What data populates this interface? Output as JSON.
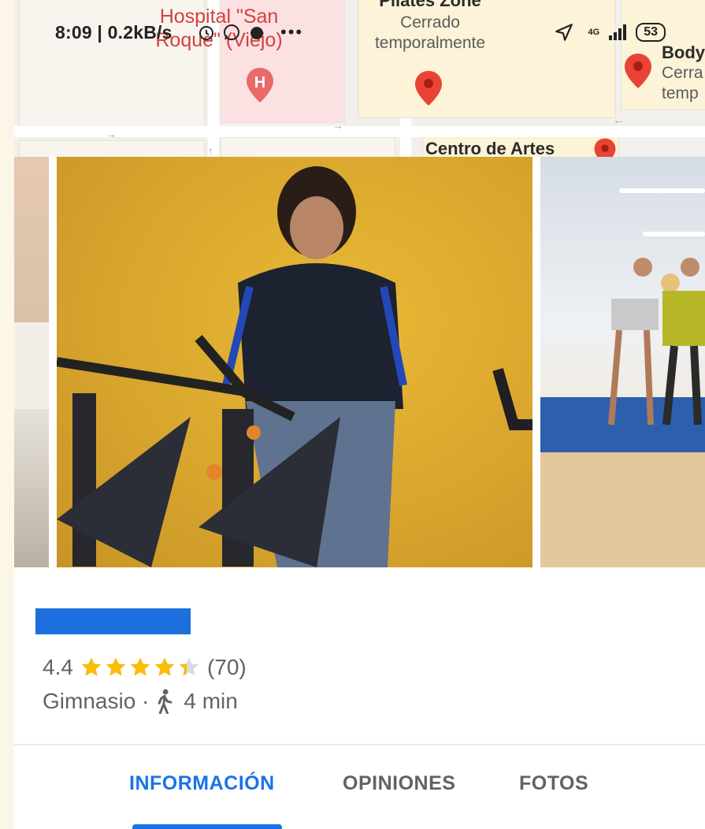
{
  "status_bar": {
    "time": "8:09 | 0.2kB/s",
    "network": "4G",
    "battery": "53"
  },
  "map": {
    "poi_hospital": "Hospital \"San Roque\" (Viejo)",
    "poi_pilates_title": "Pilates Zone",
    "poi_pilates_status": "Cerrado temporalmente",
    "poi_body_title": "Body",
    "poi_body_status": "Cerra temp",
    "poi_centro": "Centro de Artes"
  },
  "place": {
    "rating": "4.4",
    "rating_value": 4.4,
    "stars_max": 5,
    "review_count": "(70)",
    "category": "Gimnasio ·",
    "walk_time": "4 min"
  },
  "tabs": [
    {
      "label": "INFORMACIÓN",
      "active": true
    },
    {
      "label": "OPINIONES",
      "active": false
    },
    {
      "label": "FOTOS",
      "active": false
    }
  ],
  "colors": {
    "accent": "#1a73e8",
    "star": "#fbbc04",
    "pin_red": "#ea4335"
  }
}
